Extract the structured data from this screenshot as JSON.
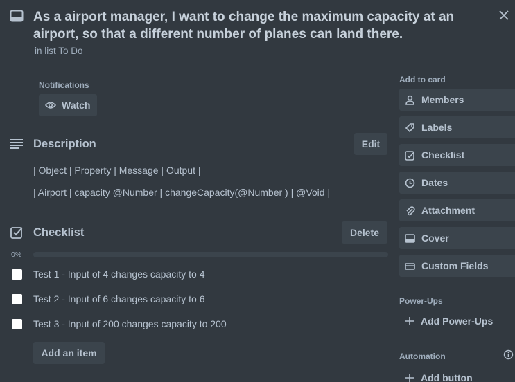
{
  "card": {
    "title": "As a airport manager, I want to change the maximum capacity at an airport, so that a different number of planes can land there.",
    "in_list_prefix": "in list",
    "list_name": "To Do"
  },
  "notifications": {
    "label": "Notifications",
    "watch_label": "Watch"
  },
  "description": {
    "heading": "Description",
    "edit_label": "Edit",
    "lines": [
      "| Object | Property | Message | Output |",
      "| Airport | capacity @Number | changeCapacity(@Number ) | @Void |"
    ]
  },
  "checklist": {
    "heading": "Checklist",
    "delete_label": "Delete",
    "progress_text": "0%",
    "progress_fraction": 0,
    "items": [
      {
        "text": "Test 1 - Input of 4 changes capacity to 4",
        "checked": false
      },
      {
        "text": "Test 2 - Input of 6 changes capacity to 6",
        "checked": false
      },
      {
        "text": "Test 3 - Input of 200 changes capacity to 200",
        "checked": false
      }
    ],
    "add_item_label": "Add an item"
  },
  "sidebar": {
    "add_to_card_label": "Add to card",
    "buttons": [
      {
        "label": "Members",
        "icon": "person-icon"
      },
      {
        "label": "Labels",
        "icon": "tag-icon"
      },
      {
        "label": "Checklist",
        "icon": "checkbox-icon"
      },
      {
        "label": "Dates",
        "icon": "clock-icon"
      },
      {
        "label": "Attachment",
        "icon": "paperclip-icon"
      },
      {
        "label": "Cover",
        "icon": "card-cover-icon"
      },
      {
        "label": "Custom Fields",
        "icon": "fields-icon"
      }
    ],
    "power_ups_label": "Power-Ups",
    "add_power_ups_label": "Add Power-Ups",
    "automation_label": "Automation",
    "add_button_label": "Add button"
  },
  "colors": {
    "background": "#323940",
    "button_bg": "#3b444c",
    "text": "#b6c2cf",
    "muted_text": "#9fadbc"
  }
}
